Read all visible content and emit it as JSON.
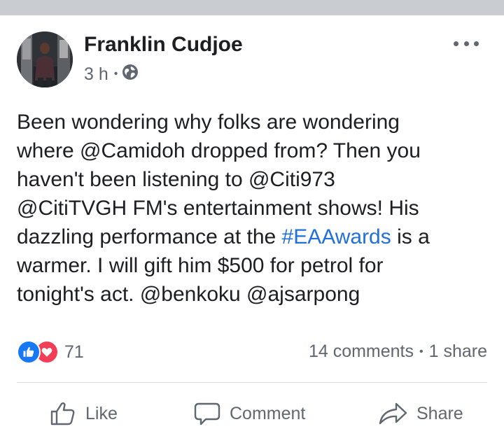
{
  "post": {
    "author": "Franklin Cudjoe",
    "time": "3 h",
    "meta_separator": "•",
    "privacy_icon": "globe-icon",
    "more_icon": "more-options-icon",
    "text_lines": [
      "Been wondering why folks are wondering",
      "where @Camidoh dropped from? Then you",
      "haven't been listening to @Citi973",
      "@CitiTVGH FM's entertainment shows! His"
    ],
    "line5_before": "dazzling performance at the ",
    "hashtag": "#EAAwards",
    "line5_after": " is a",
    "text_lines_end": [
      "warmer. I will gift him $500 for petrol for",
      "tonight's act. @benkoku @ajsarpong"
    ]
  },
  "reactions": {
    "icons": [
      "like-reaction-icon",
      "love-reaction-icon"
    ],
    "count": "71"
  },
  "engagement": {
    "comments": "14 comments",
    "separator": "•",
    "shares": "1 share"
  },
  "actions": {
    "like": "Like",
    "comment": "Comment",
    "share": "Share"
  },
  "colors": {
    "hashtag": "#216fdb",
    "like_blue": "#1877f2",
    "love_red": "#f33e58",
    "secondary_text": "#606770",
    "top_strip": "#c9ccd1"
  }
}
